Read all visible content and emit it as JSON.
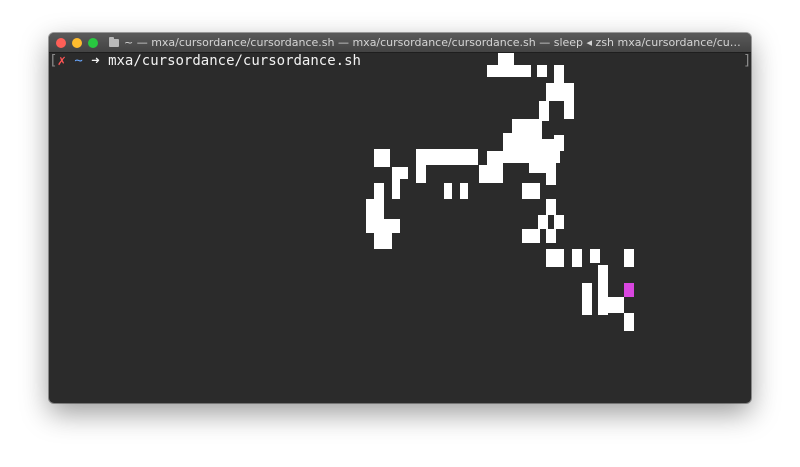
{
  "window": {
    "title": "~ — mxa/cursordance/cursordance.sh — mxa/cursordance/cursordance.sh — sleep ◂ zsh mxa/cursordance/cursordance...",
    "controls": [
      "close",
      "minimize",
      "zoom"
    ],
    "background_color": "#2b2b2b"
  },
  "prompt": {
    "open_bracket": "[",
    "status_glyph": "✗",
    "cwd": "~",
    "arrow": "➜",
    "command": "mxa/cursordance/cursordance.sh",
    "close_bracket": "]"
  },
  "colors": {
    "pixel": "#ffffff",
    "cursor": "#d946e0",
    "error": "#ff5555",
    "cwd": "#6aa8ff"
  },
  "icons": [
    "folder-icon"
  ]
}
